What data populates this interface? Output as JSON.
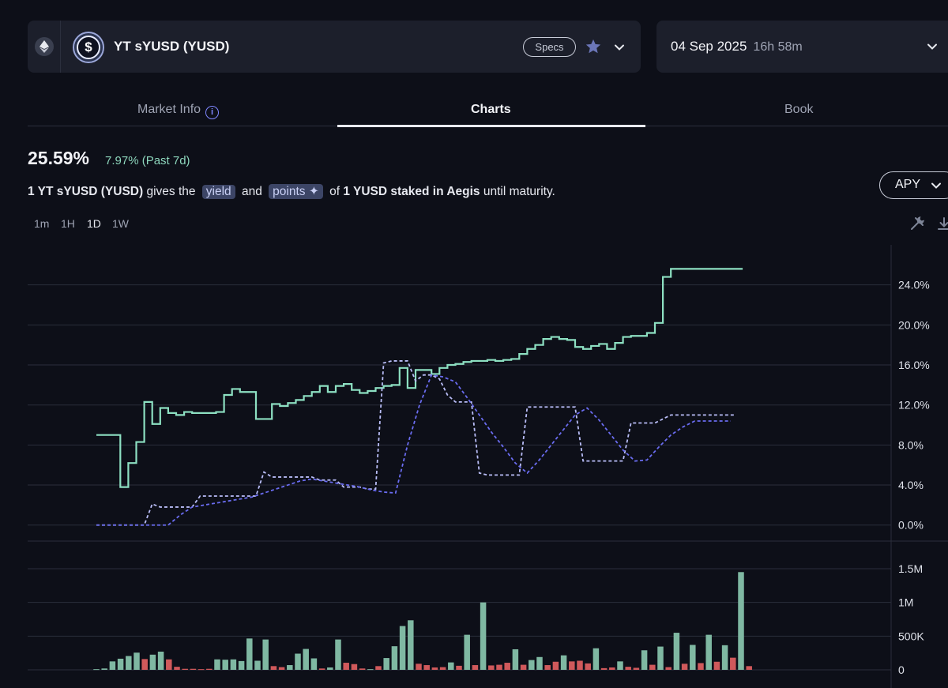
{
  "market": {
    "chain_icon": "ethereum-icon",
    "token_icon": "dollar-coin-icon",
    "name": "YT sYUSD (YUSD)",
    "specs_label": "Specs",
    "favorite_icon": "star-icon",
    "expand_icon": "chevron-down-icon"
  },
  "maturity": {
    "date": "04 Sep 2025",
    "countdown": "16h 58m",
    "expand_icon": "chevron-down-icon"
  },
  "tabs": [
    {
      "label": "Market Info",
      "icon": "info-icon",
      "active": false
    },
    {
      "label": "Charts",
      "active": true
    },
    {
      "label": "Book",
      "active": false
    }
  ],
  "summary": {
    "apy": "25.59%",
    "change": "7.97% (Past 7d)",
    "desc_prefix": "1 YT sYUSD (YUSD)",
    "desc_gives": " gives the ",
    "pill_yield": "yield",
    "desc_and": " and ",
    "pill_points": "points ✦",
    "desc_of": " of ",
    "desc_asset": "1 YUSD staked in Aegis",
    "desc_suffix": " until maturity."
  },
  "metric_select": {
    "label": "APY",
    "icon": "chevron-down-icon"
  },
  "timeframes": [
    {
      "label": "1m",
      "active": false
    },
    {
      "label": "1H",
      "active": false
    },
    {
      "label": "1D",
      "active": true
    },
    {
      "label": "1W",
      "active": false
    }
  ],
  "chart_tools": [
    "wrench-screwdriver-icon",
    "download-icon"
  ],
  "colors": {
    "implied_line": "#8de0c2",
    "underlying_line": "#b9bdf7",
    "underlying_avg": "#6a6cf0",
    "volume_up": "#7fb8a2",
    "volume_down": "#d0595b",
    "accent": "#7f86ff"
  },
  "chart_data": [
    {
      "type": "line",
      "x": [
        0,
        1,
        2,
        3,
        4,
        5,
        6,
        7,
        8,
        9,
        10,
        11,
        12,
        13,
        14,
        15,
        16,
        17,
        18,
        19,
        20,
        21,
        22,
        23,
        24,
        25,
        26,
        27,
        28,
        29,
        30,
        31,
        32,
        33,
        34,
        35,
        36,
        37,
        38,
        39,
        40,
        41,
        42,
        43,
        44,
        45,
        46,
        47,
        48,
        49,
        50,
        51,
        52,
        53,
        54,
        55,
        56,
        57,
        58,
        59,
        60,
        61,
        62,
        63,
        64,
        65,
        66,
        67,
        68,
        69,
        70,
        71,
        72,
        73,
        74,
        75,
        76,
        77,
        78,
        79,
        80
      ],
      "series": [
        {
          "style": "solid-step",
          "values": [
            9.0,
            9.0,
            9.0,
            3.8,
            6.2,
            8.3,
            12.3,
            10.1,
            11.7,
            11.2,
            11.0,
            11.3,
            11.2,
            11.2,
            11.2,
            11.3,
            13.0,
            13.6,
            13.3,
            13.3,
            10.6,
            10.6,
            12.1,
            11.9,
            12.2,
            12.5,
            12.9,
            13.3,
            13.9,
            13.3,
            13.9,
            14.1,
            13.5,
            13.2,
            13.4,
            13.7,
            13.9,
            14.0,
            15.7,
            13.7,
            15.5,
            15.5,
            15.1,
            15.7,
            16.0,
            16.1,
            16.3,
            16.4,
            16.4,
            16.5,
            16.4,
            16.5,
            16.6,
            17.1,
            17.6,
            18.0,
            18.6,
            18.8,
            18.6,
            18.5,
            17.8,
            17.6,
            17.9,
            18.1,
            17.6,
            18.2,
            18.8,
            18.9,
            18.9,
            19.2,
            20.2,
            24.8,
            25.6,
            25.6,
            25.6,
            25.6,
            25.6,
            25.6,
            25.6,
            25.6,
            25.6
          ]
        },
        {
          "style": "dashed",
          "values": [
            0.0,
            0.0,
            0.0,
            0.0,
            0.0,
            0.0,
            0.0,
            2.1,
            1.8,
            1.8,
            1.8,
            1.8,
            1.8,
            2.9,
            2.9,
            2.9,
            2.9,
            2.9,
            2.9,
            2.9,
            2.9,
            5.3,
            4.8,
            4.8,
            4.8,
            4.8,
            4.8,
            4.8,
            4.5,
            4.5,
            4.5,
            3.8,
            3.8,
            3.8,
            3.6,
            3.6,
            16.2,
            16.4,
            16.4,
            16.4,
            14.4,
            15.0,
            15.0,
            14.6,
            13.0,
            12.3,
            12.3,
            12.3,
            5.2,
            5.0,
            5.0,
            5.0,
            5.0,
            5.0,
            11.8,
            11.8,
            11.8,
            11.8,
            11.8,
            11.8,
            11.8,
            6.4,
            6.4,
            6.4,
            6.4,
            6.4,
            6.4,
            10.2,
            10.2,
            10.2,
            10.2,
            10.6,
            11.0,
            11.0,
            11.0,
            11.0,
            11.0,
            11.0,
            11.0,
            11.0,
            11.0
          ]
        },
        {
          "style": "dashed-average",
          "values": [
            0.0,
            0.0,
            0.0,
            0.0,
            0.0,
            0.0,
            0.0,
            1.0,
            1.8,
            2.0,
            2.2,
            2.4,
            2.6,
            2.8,
            3.2,
            3.6,
            4.0,
            4.4,
            4.6,
            4.4,
            4.2,
            4.0,
            3.8,
            3.5,
            3.3,
            3.2,
            8.0,
            12.0,
            15.0,
            14.8,
            14.3,
            12.7,
            11.0,
            9.3,
            7.8,
            6.2,
            5.2,
            6.5,
            8.0,
            9.5,
            11.0,
            11.7,
            10.5,
            9.0,
            7.5,
            6.4,
            6.5,
            7.8,
            9.0,
            9.8,
            10.4,
            10.4,
            10.4,
            10.4
          ]
        }
      ],
      "yaxis": {
        "position": "right",
        "ticks": [
          "24.0%",
          "20.0%",
          "16.0%",
          "12.0%",
          "8.0%",
          "4.0%",
          "0.0%"
        ],
        "range": [
          -1.6,
          28.0
        ]
      },
      "grid": true
    },
    {
      "type": "bar",
      "bars": [
        {
          "v": 10,
          "dir": "up"
        },
        {
          "v": 20,
          "dir": "up"
        },
        {
          "v": 125,
          "dir": "up"
        },
        {
          "v": 165,
          "dir": "up"
        },
        {
          "v": 205,
          "dir": "up"
        },
        {
          "v": 255,
          "dir": "up"
        },
        {
          "v": 160,
          "dir": "down"
        },
        {
          "v": 225,
          "dir": "up"
        },
        {
          "v": 270,
          "dir": "up"
        },
        {
          "v": 155,
          "dir": "down"
        },
        {
          "v": 45,
          "dir": "down"
        },
        {
          "v": 15,
          "dir": "down"
        },
        {
          "v": 15,
          "dir": "down"
        },
        {
          "v": 10,
          "dir": "down"
        },
        {
          "v": 15,
          "dir": "down"
        },
        {
          "v": 155,
          "dir": "up"
        },
        {
          "v": 150,
          "dir": "up"
        },
        {
          "v": 155,
          "dir": "up"
        },
        {
          "v": 130,
          "dir": "up"
        },
        {
          "v": 465,
          "dir": "up"
        },
        {
          "v": 135,
          "dir": "up"
        },
        {
          "v": 450,
          "dir": "up"
        },
        {
          "v": 55,
          "dir": "down"
        },
        {
          "v": 40,
          "dir": "down"
        },
        {
          "v": 70,
          "dir": "up"
        },
        {
          "v": 240,
          "dir": "up"
        },
        {
          "v": 310,
          "dir": "up"
        },
        {
          "v": 170,
          "dir": "up"
        },
        {
          "v": 20,
          "dir": "down"
        },
        {
          "v": 35,
          "dir": "up"
        },
        {
          "v": 450,
          "dir": "up"
        },
        {
          "v": 105,
          "dir": "down"
        },
        {
          "v": 85,
          "dir": "down"
        },
        {
          "v": 20,
          "dir": "down"
        },
        {
          "v": 10,
          "dir": "up"
        },
        {
          "v": 55,
          "dir": "down"
        },
        {
          "v": 175,
          "dir": "up"
        },
        {
          "v": 350,
          "dir": "up"
        },
        {
          "v": 650,
          "dir": "up"
        },
        {
          "v": 735,
          "dir": "up"
        },
        {
          "v": 90,
          "dir": "down"
        },
        {
          "v": 70,
          "dir": "down"
        },
        {
          "v": 35,
          "dir": "down"
        },
        {
          "v": 40,
          "dir": "down"
        },
        {
          "v": 110,
          "dir": "up"
        },
        {
          "v": 60,
          "dir": "down"
        },
        {
          "v": 520,
          "dir": "up"
        },
        {
          "v": 70,
          "dir": "down"
        },
        {
          "v": 1000,
          "dir": "up"
        },
        {
          "v": 65,
          "dir": "down"
        },
        {
          "v": 75,
          "dir": "down"
        },
        {
          "v": 105,
          "dir": "down"
        },
        {
          "v": 305,
          "dir": "up"
        },
        {
          "v": 75,
          "dir": "down"
        },
        {
          "v": 145,
          "dir": "up"
        },
        {
          "v": 190,
          "dir": "up"
        },
        {
          "v": 70,
          "dir": "down"
        },
        {
          "v": 120,
          "dir": "down"
        },
        {
          "v": 215,
          "dir": "up"
        },
        {
          "v": 125,
          "dir": "down"
        },
        {
          "v": 135,
          "dir": "down"
        },
        {
          "v": 95,
          "dir": "down"
        },
        {
          "v": 320,
          "dir": "up"
        },
        {
          "v": 25,
          "dir": "down"
        },
        {
          "v": 35,
          "dir": "down"
        },
        {
          "v": 125,
          "dir": "up"
        },
        {
          "v": 45,
          "dir": "down"
        },
        {
          "v": 30,
          "dir": "down"
        },
        {
          "v": 290,
          "dir": "up"
        },
        {
          "v": 75,
          "dir": "down"
        },
        {
          "v": 345,
          "dir": "up"
        },
        {
          "v": 40,
          "dir": "down"
        },
        {
          "v": 550,
          "dir": "up"
        },
        {
          "v": 90,
          "dir": "down"
        },
        {
          "v": 370,
          "dir": "up"
        },
        {
          "v": 100,
          "dir": "down"
        },
        {
          "v": 520,
          "dir": "up"
        },
        {
          "v": 120,
          "dir": "down"
        },
        {
          "v": 365,
          "dir": "up"
        },
        {
          "v": 180,
          "dir": "down"
        },
        {
          "v": 1450,
          "dir": "up"
        },
        {
          "v": 55,
          "dir": "down"
        }
      ],
      "yaxis": {
        "position": "right",
        "ticks": [
          "1.5M",
          "1M",
          "500K",
          "0"
        ],
        "range": [
          0,
          1500
        ]
      }
    }
  ]
}
